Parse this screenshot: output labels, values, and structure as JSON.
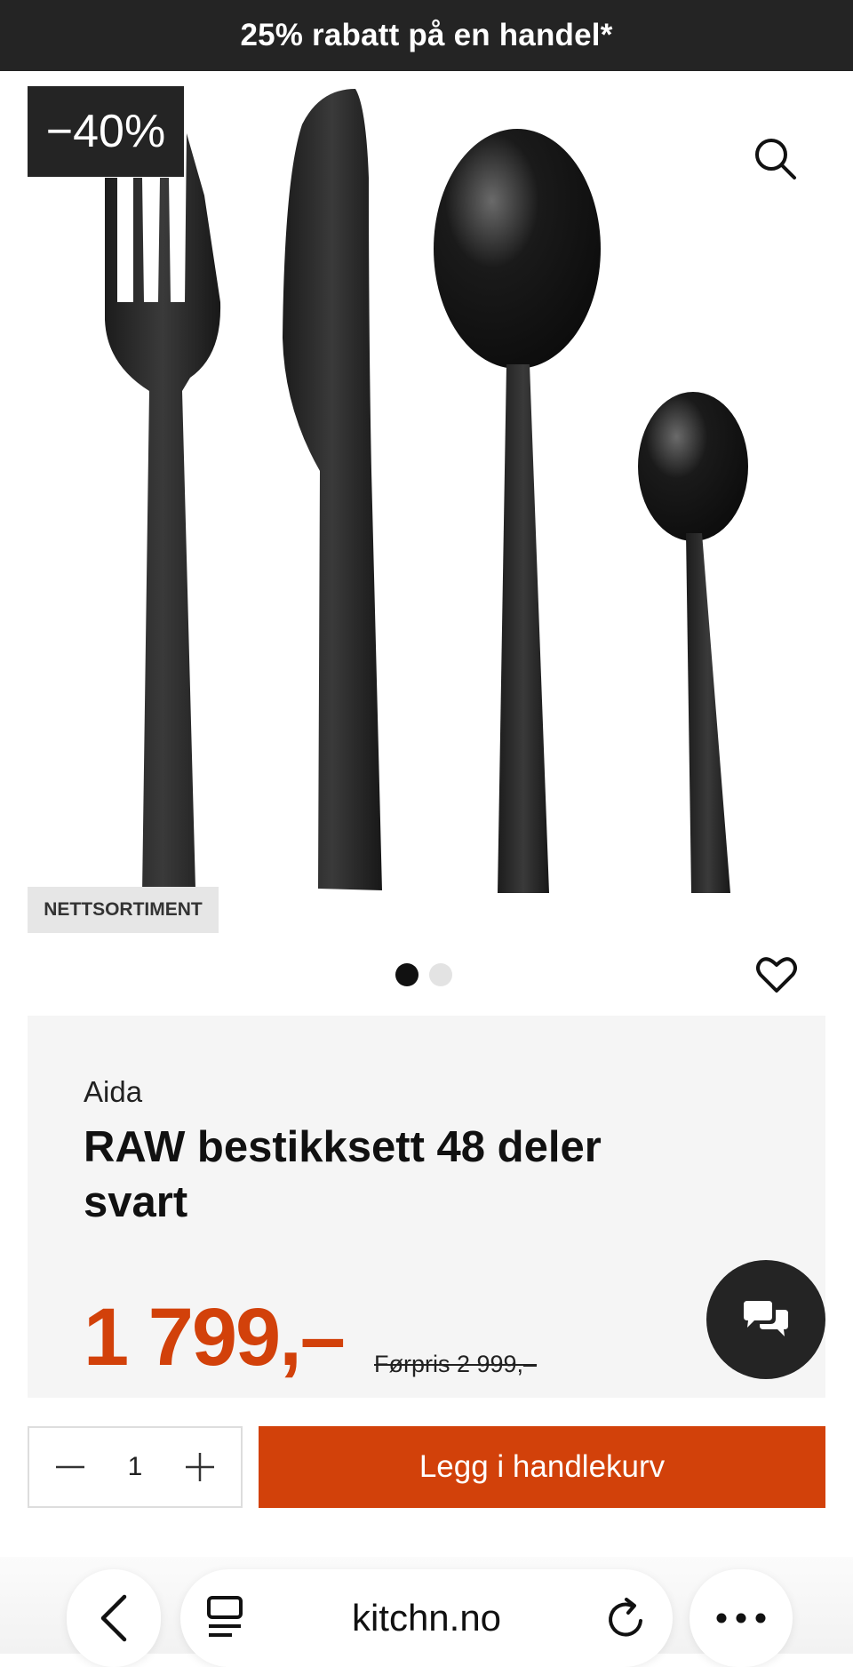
{
  "promo": {
    "text": "25% rabatt på en handel*"
  },
  "product_image": {
    "discount_badge": "−40%",
    "tag": "NETTSORTIMENT"
  },
  "carousel": {
    "dots": 2,
    "active_index": 0
  },
  "product": {
    "brand": "Aida",
    "title": "RAW bestikksett 48 deler svart",
    "price": "1 799,–",
    "old_price": "Førpris 2 999,–"
  },
  "purchase": {
    "quantity": "1",
    "add_to_cart_label": "Legg i handlekurv"
  },
  "browser": {
    "url": "kitchn.no"
  },
  "colors": {
    "accent": "#d2410a",
    "dark": "#242424",
    "card_bg": "#f5f5f5"
  },
  "icons": [
    "search-icon",
    "heart-icon",
    "chat-icon",
    "minus-icon",
    "plus-icon",
    "back-icon",
    "tabs-icon",
    "reload-icon",
    "more-icon"
  ]
}
